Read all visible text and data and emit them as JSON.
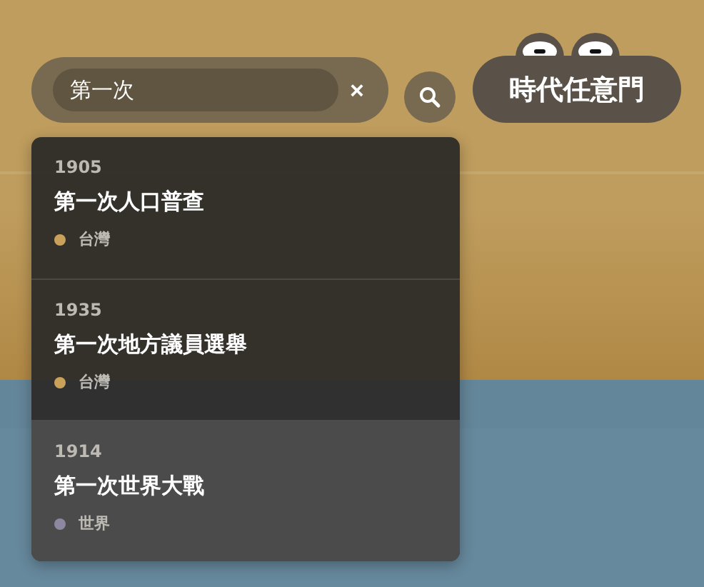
{
  "search": {
    "value": "第一次",
    "clear": "×"
  },
  "logo": {
    "text": "時代任意門"
  },
  "results": [
    {
      "year": "1905",
      "title": "第一次人口普查",
      "region": "台灣",
      "color": "#c9a15a",
      "selected": false
    },
    {
      "year": "1935",
      "title": "第一次地方議員選舉",
      "region": "台灣",
      "color": "#c9a15a",
      "selected": false
    },
    {
      "year": "1914",
      "title": "第一次世界大戰",
      "region": "世界",
      "color": "#8e87a0",
      "selected": true
    }
  ]
}
